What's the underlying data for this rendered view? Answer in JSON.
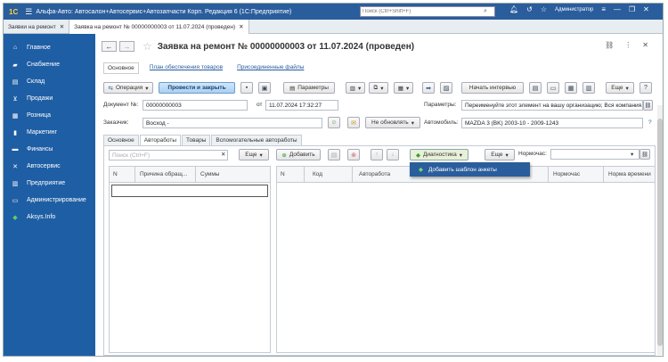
{
  "app": {
    "logo": "1С",
    "title": "Альфа-Авто: Автосалон+Автосервис+Автозапчасти Корп. Редакция 6  (1С:Предприятие)",
    "search_placeholder": "Поиск (Ctrl+Shift+F)",
    "user": "Администратор"
  },
  "window_tabs": [
    {
      "label": "Заявки на ремонт"
    },
    {
      "label": "Заявка на ремонт № 00000000003 от 11.07.2024 (проведен)"
    }
  ],
  "sidebar": {
    "items": [
      {
        "label": "Главное",
        "icon": "home-icon"
      },
      {
        "label": "Снабжение",
        "icon": "truck-icon"
      },
      {
        "label": "Склад",
        "icon": "warehouse-icon"
      },
      {
        "label": "Продажи",
        "icon": "cart-icon"
      },
      {
        "label": "Розница",
        "icon": "register-icon"
      },
      {
        "label": "Маркетинг",
        "icon": "chart-icon"
      },
      {
        "label": "Финансы",
        "icon": "money-icon"
      },
      {
        "label": "Автосервис",
        "icon": "wrench-icon"
      },
      {
        "label": "Предприятие",
        "icon": "building-icon"
      },
      {
        "label": "Администрирование",
        "icon": "monitor-icon"
      },
      {
        "label": "Aksys.Info",
        "icon": "leaf-icon"
      }
    ]
  },
  "document": {
    "title": "Заявка на ремонт № 00000000003 от 11.07.2024 (проведен)",
    "subtabs": [
      "Основное",
      "План обеспечения товаров",
      "Присоединенные файлы"
    ],
    "toolbar": {
      "operation": "Операция",
      "post_close": "Провести и закрыть",
      "params": "Параметры",
      "interview": "Начать интервью",
      "more": "Еще",
      "help": "?"
    },
    "fields": {
      "doc_no_label": "Документ №:",
      "doc_no": "00000000003",
      "from_label": "от",
      "date": "11.07.2024 17:32:27",
      "params_label": "Параметры:",
      "params_value": "Переименуйте этот элемент на вашу организацию; Вся компания...",
      "customer_label": "Заказчик:",
      "customer": "Восход -",
      "no_update": "Не обновлять",
      "car_label": "Автомобиль:",
      "car": "MAZDA 3 (BK) 2003-10 - 2009-1243"
    },
    "form_tabs": [
      "Основное",
      "Автоработы",
      "Товары",
      "Вспомогательные автоработы"
    ],
    "left_panel": {
      "search_placeholder": "Поиск (Ctrl+F)",
      "more": "Еще",
      "columns": [
        "N",
        "Причина обращ...",
        "Суммы"
      ]
    },
    "right_panel": {
      "add": "Добавить",
      "diagnostics": "Диагностика",
      "more": "Еще",
      "normochas_label": "Нормочас:",
      "columns": [
        "N",
        "Код",
        "Авторабота",
        "Нормочас",
        "Норма времени"
      ]
    },
    "dropdown_item": "Добавить шаблон анкеты"
  }
}
